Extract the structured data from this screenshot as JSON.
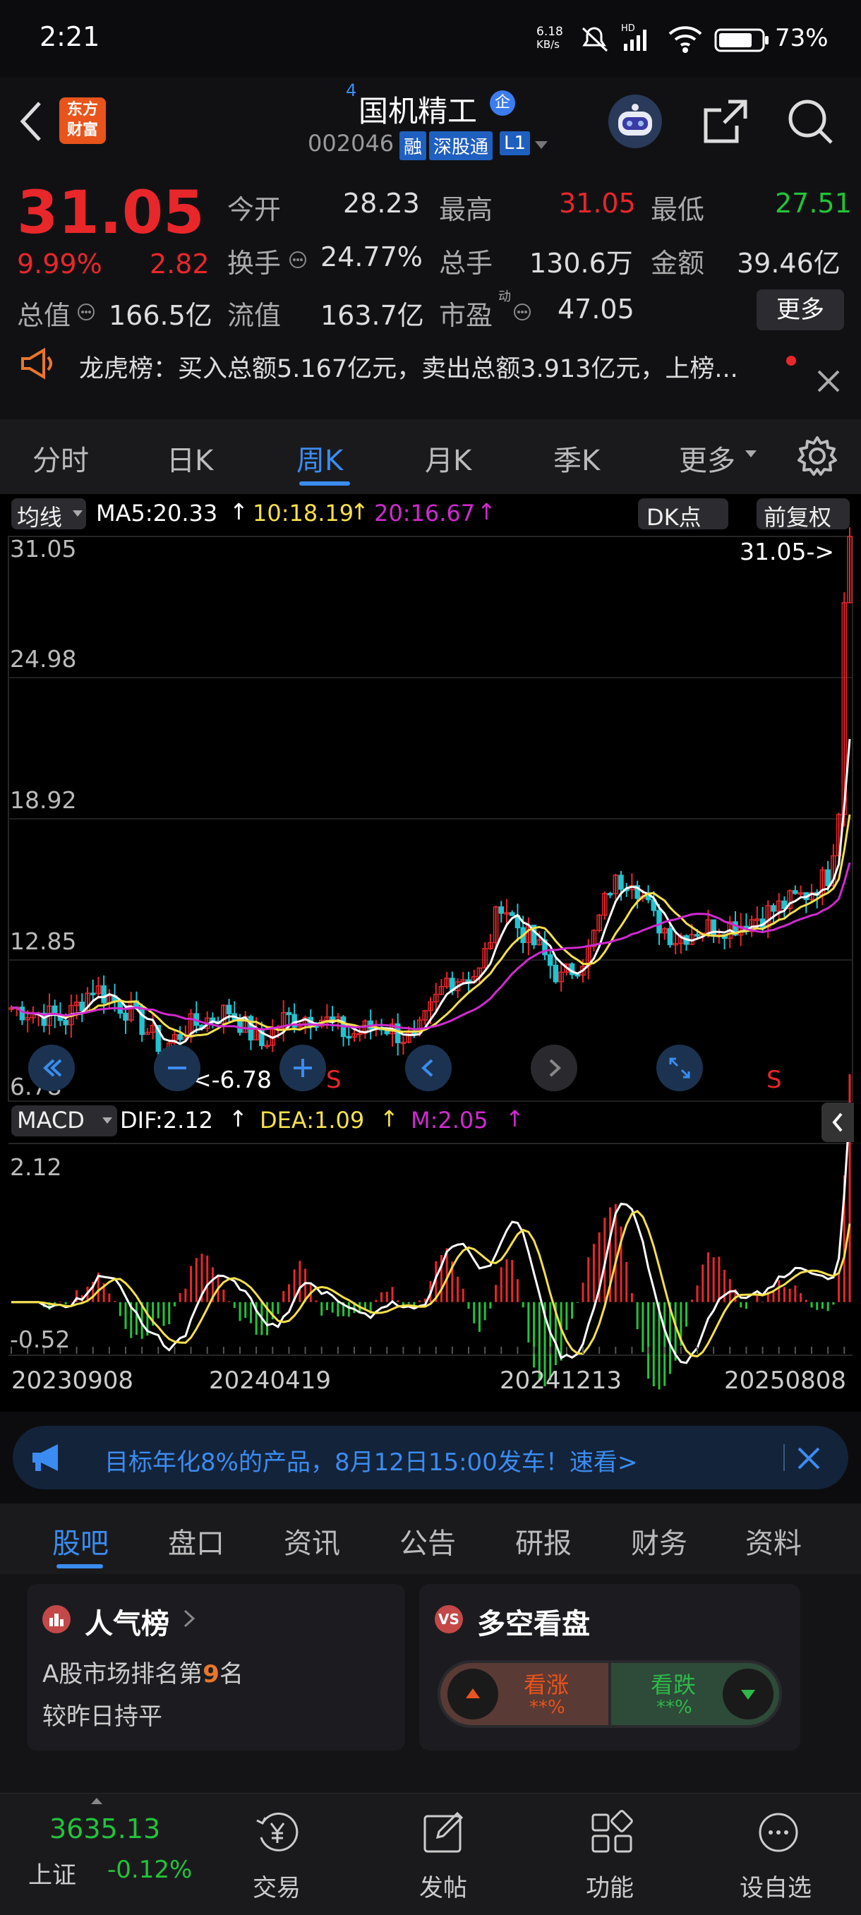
{
  "status": {
    "time": "2:21",
    "net_speed_top": "6.18",
    "net_speed_unit": "KB/s",
    "battery": "73%",
    "hd": "HD"
  },
  "header": {
    "title": "国机精工",
    "title_sup": "4",
    "badge": "企",
    "code": "002046",
    "tag1": "融",
    "tag2": "深股通",
    "tag3": "L1",
    "logo_line1": "东方",
    "logo_line2": "财富"
  },
  "quote": {
    "price": "31.05",
    "pct": "9.99%",
    "change": "2.82",
    "open_label": "今开",
    "open": "28.23",
    "high_label": "最高",
    "high": "31.05",
    "low_label": "最低",
    "low": "27.51",
    "turnover_label": "换手",
    "turnover": "24.77%",
    "volume_label": "总手",
    "volume": "130.6万",
    "amount_label": "金额",
    "amount": "39.46亿",
    "mcap_label": "总值",
    "mcap": "166.5亿",
    "float_label": "流值",
    "float": "163.7亿",
    "pe_label": "市盈",
    "pe_sup": "动",
    "pe": "47.05",
    "more": "更多"
  },
  "notice": {
    "text": "龙虎榜：买入总额5.167亿元，卖出总额3.913亿元，上榜..."
  },
  "tabs": [
    "分时",
    "日K",
    "周K",
    "月K",
    "季K",
    "更多"
  ],
  "active_tab": 2,
  "ma": {
    "label": "均线",
    "ma5": "MA5:20.33",
    "ma10": "10:18.19",
    "ma20": "20:16.67",
    "dk": "DK点",
    "fq": "前复权"
  },
  "kline_axis": {
    "y1": "31.05",
    "y2": "24.98",
    "y3": "18.92",
    "y4": "12.85",
    "y5": "6.78",
    "max_label": "31.05->",
    "min_label": "<-6.78",
    "s1": "S",
    "s2": "S"
  },
  "macd": {
    "label": "MACD",
    "dif": "DIF:2.12",
    "dea": "DEA:1.09",
    "m": "M:2.05",
    "top": "2.12",
    "bottom": "-0.52"
  },
  "dates": [
    "20230908",
    "20240419",
    "20241213",
    "20250808"
  ],
  "ad": {
    "text": "目标年化8%的产品，8月12日15:00发车！速看>"
  },
  "subtabs": [
    "股吧",
    "盘口",
    "资讯",
    "公告",
    "研报",
    "财务",
    "资料"
  ],
  "card1": {
    "title": "人气榜",
    "line1a": "A股市场排名第",
    "rank": "9",
    "line1b": "名",
    "line2": "较昨日持平"
  },
  "card2": {
    "title": "多空看盘",
    "up": "看涨",
    "up_val": "**%",
    "down": "看跌",
    "down_val": "**%"
  },
  "bottom": {
    "index": "3635.13",
    "index_name": "上证",
    "index_pct": "-0.12%",
    "nav": [
      "交易",
      "发帖",
      "功能",
      "设自选"
    ]
  },
  "colors": {
    "red": "#e8272b",
    "green": "#22c33a",
    "yellow": "#f5e04a",
    "magenta": "#d02ad0",
    "blue_tab": "#3b8cf0"
  },
  "chart_data": {
    "type": "candlestick",
    "ylim": [
      6.78,
      31.05
    ],
    "ma_values": {
      "MA5": 20.33,
      "MA10": 18.19,
      "MA20": 16.67
    },
    "macd": {
      "DIF": 2.12,
      "DEA": 1.09,
      "M": 2.05
    }
  }
}
